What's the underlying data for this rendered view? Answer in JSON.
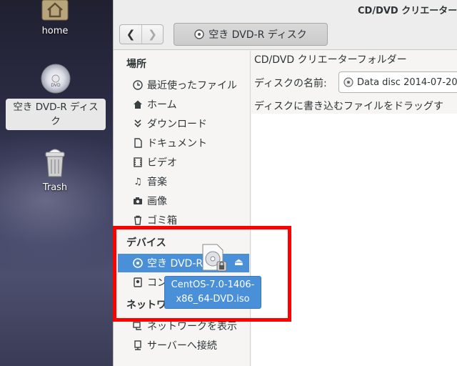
{
  "desktop": {
    "home_label": "home",
    "dvd_label": "空き DVD-R ディスク",
    "trash_label": "Trash"
  },
  "window": {
    "title": "CD/DVD クリエーター"
  },
  "toolbar": {
    "back_icon": "chevron-left-icon",
    "forward_icon": "chevron-right-icon",
    "path_label": "空き DVD-R ディスク"
  },
  "sidebar": {
    "places_header": "場所",
    "places": [
      {
        "label": "最近使ったファイル",
        "icon": "clock-icon"
      },
      {
        "label": "ホーム",
        "icon": "home-icon"
      },
      {
        "label": "ダウンロード",
        "icon": "download-icon"
      },
      {
        "label": "ドキュメント",
        "icon": "document-icon"
      },
      {
        "label": "ビデオ",
        "icon": "film-icon"
      },
      {
        "label": "音楽",
        "icon": "music-icon"
      },
      {
        "label": "画像",
        "icon": "camera-icon"
      },
      {
        "label": "ゴミ箱",
        "icon": "trash-icon"
      }
    ],
    "devices_header": "デバイス",
    "devices": [
      {
        "label": "空き DVD-R",
        "icon": "disc-icon",
        "selected": true
      },
      {
        "label": "コン",
        "icon": "computer-icon"
      }
    ],
    "network_header": "ネットワ",
    "network": [
      {
        "label": "ネットワークを表示",
        "icon": "network-icon"
      },
      {
        "label": "サーバーへ接続",
        "icon": "server-icon"
      }
    ]
  },
  "main": {
    "folder_title": "CD/DVD クリエーターフォルダー",
    "disc_name_label": "ディスクの名前:",
    "disc_name_value": "Data disc 2014-07-20",
    "drag_hint": "ディスクに書き込むファイルをドラッグす"
  },
  "drag": {
    "filename": "CentOS-7.0-1406-x86_64-DVD.iso",
    "line1": "CentOS-7.0-1406-",
    "line2": "x86_64-DVD.iso"
  },
  "colors": {
    "selection": "#4a90d9",
    "highlight": "#ff0000"
  }
}
